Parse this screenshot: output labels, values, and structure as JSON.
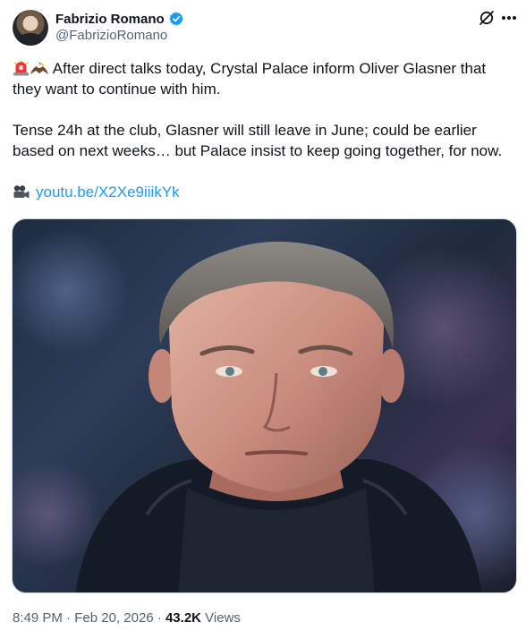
{
  "author": {
    "display_name": "Fabrizio Romano",
    "handle": "@FabrizioRomano",
    "verified": true
  },
  "header_icons": [
    "grok-icon",
    "more-icon"
  ],
  "tweet": {
    "line1": "After direct talks today, Crystal Palace inform Oliver Glasner that they want to continue with him.",
    "line2": "Tense 24h at the club, Glasner will still leave in June; could be earlier based on next weeks… but Palace insist to keep going together, for now.",
    "link": "youtu.be/X2Xe9iiikYk",
    "emojis": [
      "siren-emoji",
      "eagle-emoji",
      "camera-emoji"
    ]
  },
  "media": {
    "type": "photo"
  },
  "footer": {
    "time": "8:49 PM",
    "date": "Feb 20, 2026",
    "views_count": "43.2K",
    "views_label": "Views"
  },
  "colors": {
    "text": "#0f1419",
    "muted": "#536471",
    "link": "#1d9bf0",
    "verified": "#1d9bf0"
  }
}
